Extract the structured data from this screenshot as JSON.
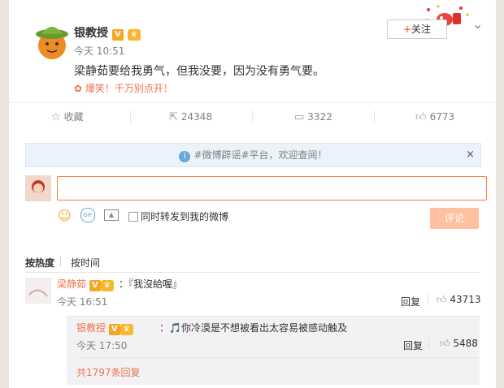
{
  "post": {
    "author": "银教授",
    "verified_badge": "V",
    "time": "今天 10:51",
    "text": "梁静茹要给我勇气，但我没要，因为没有勇气要。",
    "link_text": "爆笑！千万别点开！",
    "follow_label": "关注"
  },
  "actions": {
    "favorite_label": "收藏",
    "repost_count": "24348",
    "comment_count": "3322",
    "like_count": "6773"
  },
  "notice": {
    "text": "#微博辟谣#平台，欢迎查阅！",
    "close": "×"
  },
  "composer": {
    "repost_label": "同时转发到我的微博",
    "submit_label": "评论",
    "input_value": ""
  },
  "sort": {
    "hot": "按热度",
    "time": "按时间"
  },
  "comments": [
    {
      "author": "梁静茹",
      "text": "：『我沒給喔』",
      "time": "今天 16:51",
      "reply_label": "回复",
      "likes": "43713",
      "replies": [
        {
          "author": "银教授",
          "text": "：🎵你冷漠是不想被看出太容易被感动触及",
          "time": "今天 17:50",
          "reply_label": "回复",
          "likes": "5488"
        }
      ],
      "more_replies": "共1797条回复"
    }
  ],
  "colors": {
    "accent": "#eb7350",
    "verified": "#f6a623",
    "submit_disabled": "#ffc09f"
  }
}
